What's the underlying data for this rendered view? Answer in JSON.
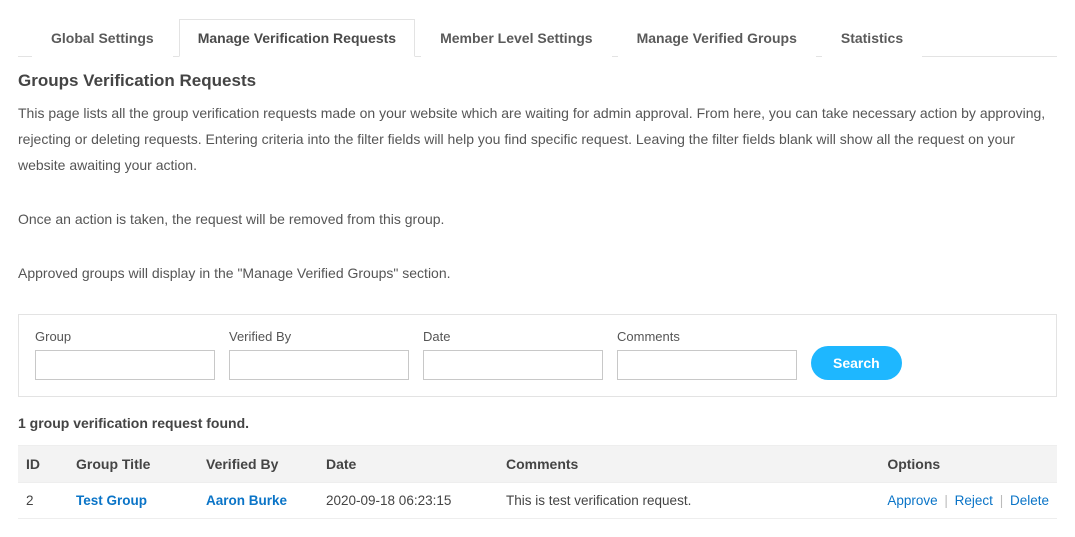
{
  "tabs": [
    {
      "label": "Global Settings",
      "active": false
    },
    {
      "label": "Manage Verification Requests",
      "active": true
    },
    {
      "label": "Member Level Settings",
      "active": false
    },
    {
      "label": "Manage Verified Groups",
      "active": false
    },
    {
      "label": "Statistics",
      "active": false
    }
  ],
  "page": {
    "title": "Groups Verification Requests",
    "desc1": "This page lists all the group verification requests made on your website which are waiting for admin approval. From here, you can take necessary action by approving, rejecting or deleting requests. Entering criteria into the filter fields will help you find specific request. Leaving the filter fields blank will show all the request on your website awaiting your action.",
    "desc2": "Once an action is taken, the request will be removed from this group.",
    "desc3": "Approved groups will display in the \"Manage Verified Groups\" section."
  },
  "filters": {
    "group": {
      "label": "Group",
      "value": ""
    },
    "verified_by": {
      "label": "Verified By",
      "value": ""
    },
    "date": {
      "label": "Date",
      "value": ""
    },
    "comments": {
      "label": "Comments",
      "value": ""
    },
    "search_label": "Search"
  },
  "results": {
    "count_text": "1 group verification request found.",
    "columns": {
      "id": "ID",
      "group_title": "Group Title",
      "verified_by": "Verified By",
      "date": "Date",
      "comments": "Comments",
      "options": "Options"
    },
    "rows": [
      {
        "id": "2",
        "group_title": "Test Group",
        "verified_by": "Aaron Burke",
        "date": "2020-09-18 06:23:15",
        "comments": "This is test verification request."
      }
    ],
    "actions": {
      "approve": "Approve",
      "reject": "Reject",
      "delete": "Delete"
    }
  }
}
